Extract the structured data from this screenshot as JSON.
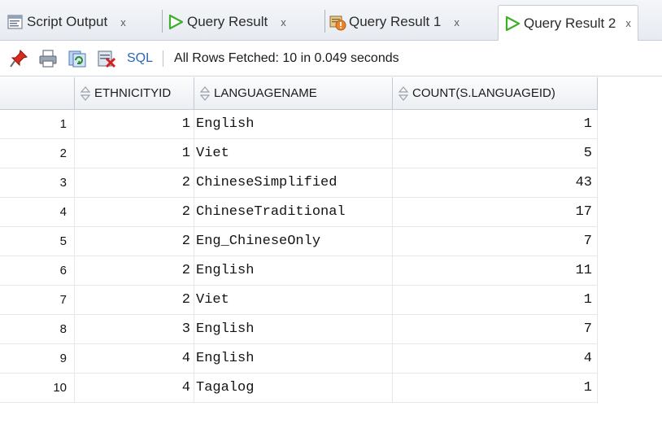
{
  "tabs": [
    {
      "label": "Script Output",
      "close": "x",
      "icon": "script-output-icon"
    },
    {
      "label": "Query Result",
      "close": "x",
      "icon": "run-arrow-icon"
    },
    {
      "label": "Query Result 1",
      "close": "x",
      "icon": "query-warning-icon"
    },
    {
      "label": "Query Result 2",
      "close": "x",
      "icon": "run-arrow-icon",
      "active": true
    }
  ],
  "toolbar": {
    "icons": [
      "pin-icon",
      "print-icon",
      "refresh-icon",
      "export-icon"
    ],
    "sql_label": "SQL",
    "divider": "|",
    "status": "All Rows Fetched: 10 in 0.049 seconds"
  },
  "grid": {
    "columns": [
      "ETHNICITYID",
      "LANGUAGENAME",
      "COUNT(S.LANGUAGEID)"
    ],
    "rows": [
      {
        "n": "1",
        "eth": "1",
        "lang": "English",
        "count": "1"
      },
      {
        "n": "2",
        "eth": "1",
        "lang": "Viet",
        "count": "5"
      },
      {
        "n": "3",
        "eth": "2",
        "lang": "ChineseSimplified",
        "count": "43"
      },
      {
        "n": "4",
        "eth": "2",
        "lang": "ChineseTraditional",
        "count": "17"
      },
      {
        "n": "5",
        "eth": "2",
        "lang": "Eng_ChineseOnly",
        "count": "7"
      },
      {
        "n": "6",
        "eth": "2",
        "lang": "English",
        "count": "11"
      },
      {
        "n": "7",
        "eth": "2",
        "lang": "Viet",
        "count": "1"
      },
      {
        "n": "8",
        "eth": "3",
        "lang": "English",
        "count": "7"
      },
      {
        "n": "9",
        "eth": "4",
        "lang": "English",
        "count": "4"
      },
      {
        "n": "10",
        "eth": "4",
        "lang": "Tagalog",
        "count": "1"
      }
    ]
  },
  "colors": {
    "run_arrow": "#3fae2a",
    "sql_link": "#2b67b8",
    "warning": "#e8842c"
  }
}
